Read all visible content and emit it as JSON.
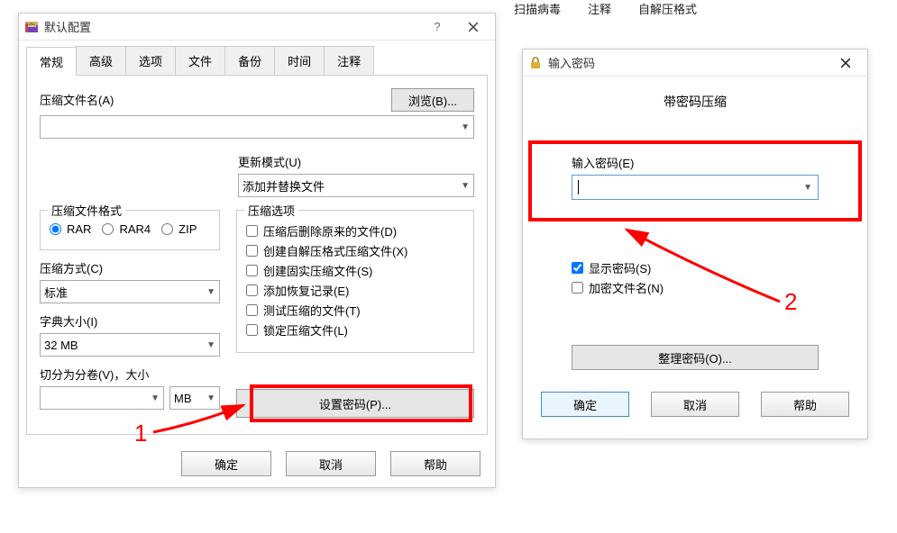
{
  "toolbar_bg": {
    "scan": "扫描病毒",
    "comment": "注释",
    "sfx": "自解压格式"
  },
  "main": {
    "title": "默认配置",
    "tabs": [
      "常规",
      "高级",
      "选项",
      "文件",
      "备份",
      "时间",
      "注释"
    ],
    "archive_name_label": "压缩文件名(A)",
    "browse_btn": "浏览(B)...",
    "archive_name_value": "",
    "update_mode_label": "更新模式(U)",
    "update_mode_value": "添加并替换文件",
    "format_group": "压缩文件格式",
    "formats": {
      "rar": "RAR",
      "rar4": "RAR4",
      "zip": "ZIP"
    },
    "method_label": "压缩方式(C)",
    "method_value": "标准",
    "dict_label": "字典大小(I)",
    "dict_value": "32 MB",
    "split_label": "切分为分卷(V)，大小",
    "split_value": "",
    "split_unit": "MB",
    "options_group": "压缩选项",
    "options": [
      "压缩后删除原来的文件(D)",
      "创建自解压格式压缩文件(X)",
      "创建固实压缩文件(S)",
      "添加恢复记录(E)",
      "测试压缩的文件(T)",
      "锁定压缩文件(L)"
    ],
    "set_password_btn": "设置密码(P)...",
    "ok": "确定",
    "cancel": "取消",
    "help": "帮助"
  },
  "pw": {
    "title": "输入密码",
    "subtitle": "带密码压缩",
    "enter_label": "输入密码(E)",
    "enter_value": "",
    "show_pw": "显示密码(S)",
    "encrypt_names": "加密文件名(N)",
    "manage": "整理密码(O)...",
    "ok": "确定",
    "cancel": "取消",
    "help": "帮助"
  },
  "annotations": {
    "one": "1",
    "two": "2"
  }
}
